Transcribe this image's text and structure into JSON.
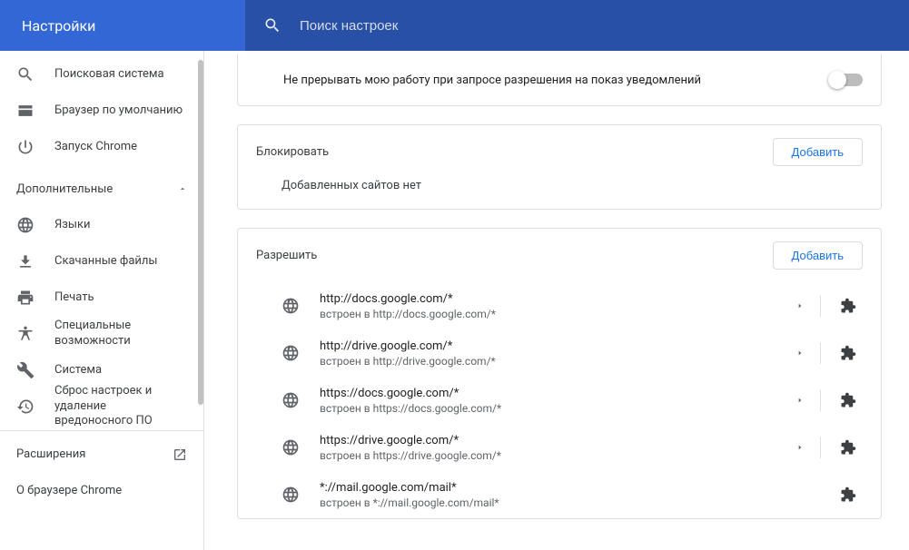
{
  "header": {
    "title": "Настройки",
    "search_placeholder": "Поиск настроек"
  },
  "sidebar": {
    "items_top": [
      {
        "icon": "search",
        "label": "Поисковая система"
      },
      {
        "icon": "browser",
        "label": "Браузер по умолчанию"
      },
      {
        "icon": "power",
        "label": "Запуск Chrome"
      }
    ],
    "advanced_label": "Дополнительные",
    "items_adv": [
      {
        "icon": "globe",
        "label": "Языки"
      },
      {
        "icon": "download",
        "label": "Скачанные файлы"
      },
      {
        "icon": "print",
        "label": "Печать"
      },
      {
        "icon": "accessibility",
        "label": "Специальные возможности"
      },
      {
        "icon": "wrench",
        "label": "Система"
      },
      {
        "icon": "restore",
        "label": "Сброс настроек и удаление вредоносного ПО"
      }
    ],
    "footer": {
      "extensions": "Расширения",
      "about": "О браузере Chrome"
    }
  },
  "content": {
    "notif_row": "Не прерывать мою работу при запросе разрешения на показ уведомлений",
    "block": {
      "title": "Блокировать",
      "add": "Добавить",
      "empty": "Добавленных сайтов нет"
    },
    "allow": {
      "title": "Разрешить",
      "add": "Добавить",
      "embed_prefix": "встроен в ",
      "sites": [
        {
          "url": "http://docs.google.com/*",
          "embed": "http://docs.google.com/*"
        },
        {
          "url": "http://drive.google.com/*",
          "embed": "http://drive.google.com/*"
        },
        {
          "url": "https://docs.google.com/*",
          "embed": "https://docs.google.com/*"
        },
        {
          "url": "https://drive.google.com/*",
          "embed": "https://drive.google.com/*"
        },
        {
          "url": "*://mail.google.com/mail*",
          "embed": "*://mail.google.com/mail*"
        }
      ]
    }
  }
}
